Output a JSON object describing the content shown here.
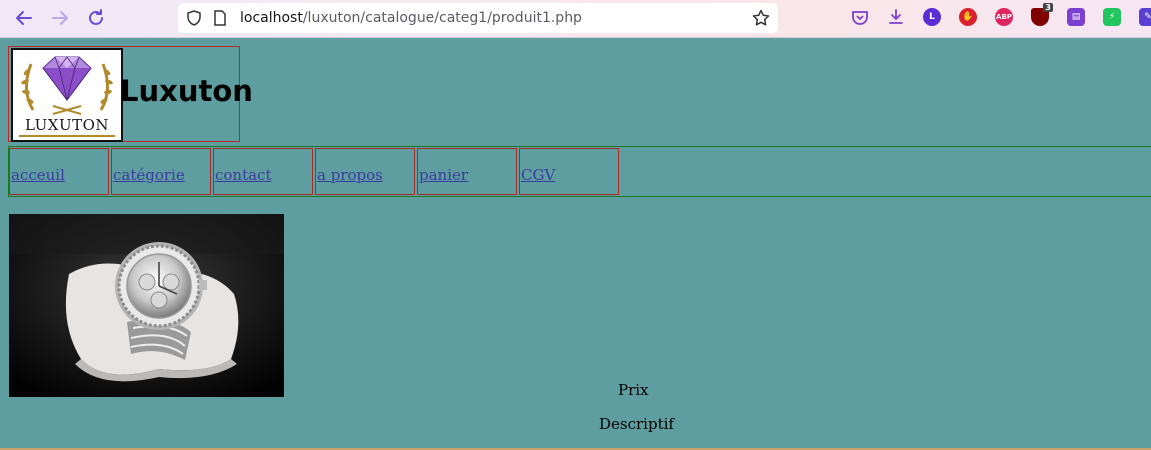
{
  "browser": {
    "url_host": "localhost",
    "url_path": "/luxuton/catalogue/categ1/produit1.php",
    "extensions": [
      {
        "name": "pocket-icon",
        "label": "",
        "color": "#e0245e"
      },
      {
        "name": "download-icon",
        "label": "",
        "color": "#5b3fd1"
      },
      {
        "name": "extension-l-icon",
        "label": "L",
        "color": "#5b2bd6"
      },
      {
        "name": "stop-hand-icon",
        "label": "",
        "color": "#d8212c"
      },
      {
        "name": "adblock-plus-icon",
        "label": "ABP",
        "color": "#e0245e"
      },
      {
        "name": "ublock-icon",
        "label": "3",
        "color": "#800000"
      },
      {
        "name": "reader-icon",
        "label": "",
        "color": "#7b3fd1"
      },
      {
        "name": "bolt-extension-icon",
        "label": "",
        "color": "#22c55e"
      },
      {
        "name": "edit-extension-icon",
        "label": "",
        "color": "#5b3fd1"
      }
    ]
  },
  "site": {
    "logo_text": "LUXUTON",
    "title": "Luxuton"
  },
  "menu": [
    {
      "label": "acceuil"
    },
    {
      "label": "catégorie"
    },
    {
      "label": "contact"
    },
    {
      "label": "a propos"
    },
    {
      "label": "panier"
    },
    {
      "label": "CGV"
    }
  ],
  "product": {
    "image": "luxury-diamond-watch",
    "price_label": "Prix",
    "description_label": "Descriptif"
  }
}
